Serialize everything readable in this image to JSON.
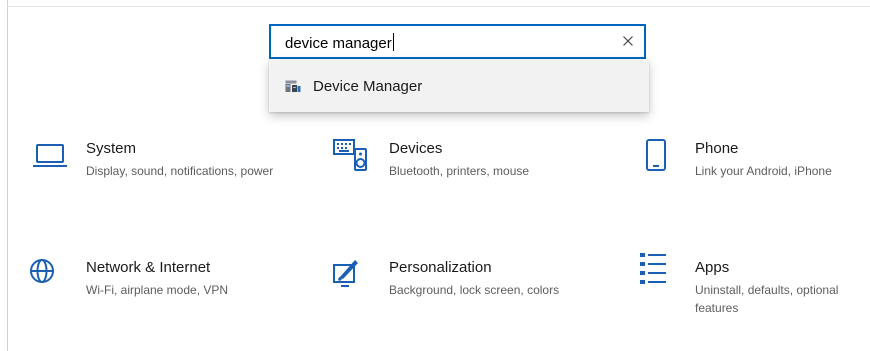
{
  "search": {
    "value": "device manager",
    "clear_label": "×"
  },
  "suggestions": [
    {
      "label": "Device Manager",
      "icon": "device-manager-icon"
    }
  ],
  "categories": [
    {
      "title": "System",
      "description": "Display, sound, notifications, power",
      "icon": "laptop-icon"
    },
    {
      "title": "Devices",
      "description": "Bluetooth, printers, mouse",
      "icon": "keyboard-speaker-icon"
    },
    {
      "title": "Phone",
      "description": "Link your Android, iPhone",
      "icon": "phone-icon"
    },
    {
      "title": "Network & Internet",
      "description": "Wi-Fi, airplane mode, VPN",
      "icon": "globe-icon"
    },
    {
      "title": "Personalization",
      "description": "Background, lock screen, colors",
      "icon": "paint-brush-icon"
    },
    {
      "title": "Apps",
      "description": "Uninstall, defaults, optional features",
      "icon": "apps-list-icon"
    }
  ],
  "colors": {
    "accent": "#0067c0",
    "icon": "#1a5fb4",
    "text": "#1a1a1a",
    "secondary_text": "#5d5d5d",
    "suggestion_bg": "#f2f2f2"
  }
}
